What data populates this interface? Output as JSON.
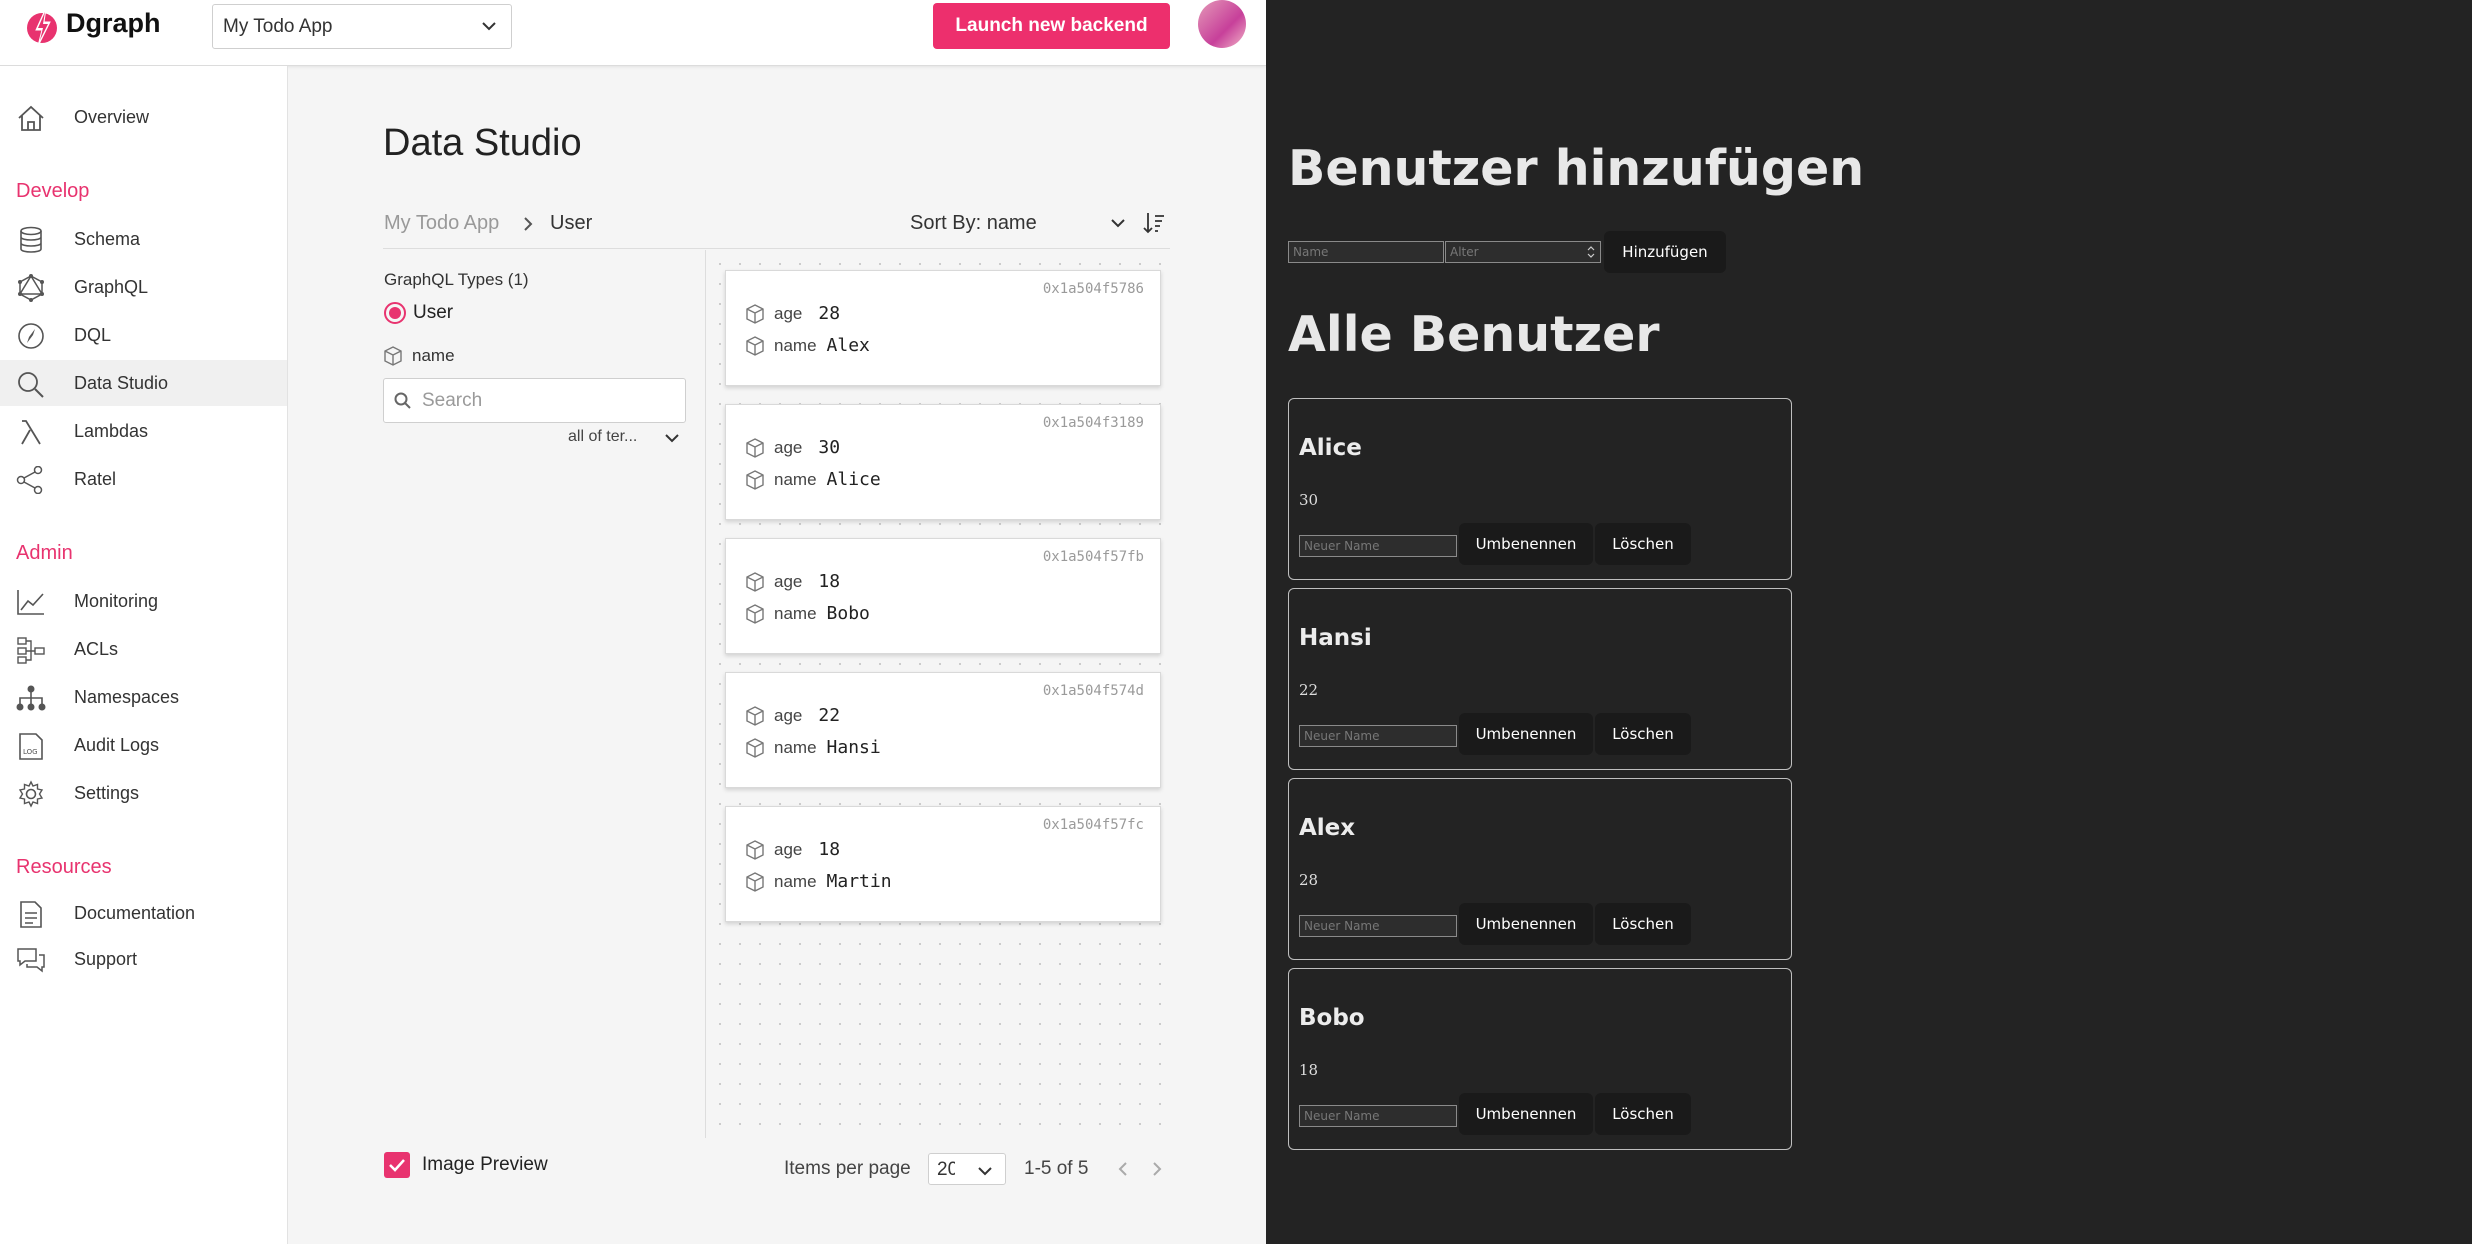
{
  "app": {
    "logo_text": "Dgraph",
    "backend_select": "My Todo App",
    "launch_button": "Launch new backend",
    "colors": {
      "accent": "#e8336f",
      "sidebar_active": "#f0f0f0",
      "dark_bg": "#232323"
    }
  },
  "sidebar": {
    "overview": "Overview",
    "develop_heading": "Develop",
    "develop": [
      {
        "label": "Schema",
        "icon": "database-icon"
      },
      {
        "label": "GraphQL",
        "icon": "graphql-icon"
      },
      {
        "label": "DQL",
        "icon": "compass-icon"
      },
      {
        "label": "Data Studio",
        "icon": "search-icon"
      },
      {
        "label": "Lambdas",
        "icon": "lambda-icon"
      },
      {
        "label": "Ratel",
        "icon": "graph-nodes-icon"
      }
    ],
    "admin_heading": "Admin",
    "admin": [
      {
        "label": "Monitoring",
        "icon": "line-chart-icon"
      },
      {
        "label": "ACLs",
        "icon": "acl-icon"
      },
      {
        "label": "Namespaces",
        "icon": "hierarchy-icon"
      },
      {
        "label": "Audit Logs",
        "icon": "log-file-icon"
      },
      {
        "label": "Settings",
        "icon": "gear-icon"
      }
    ],
    "resources_heading": "Resources",
    "resources": [
      {
        "label": "Documentation",
        "icon": "document-icon"
      },
      {
        "label": "Support",
        "icon": "chat-icon"
      }
    ]
  },
  "studio": {
    "title": "Data Studio",
    "breadcrumb_root": "My Todo App",
    "breadcrumb_type": "User",
    "sort_label": "Sort By: name",
    "types_heading": "GraphQL Types (1)",
    "type_option": "User",
    "field_name": "name",
    "search_placeholder": "Search",
    "filter_mode": "all of ter...",
    "image_preview_label": "Image Preview",
    "items_per_page_label": "Items per page",
    "items_per_page_value": "20",
    "pagination_text": "1-5 of 5",
    "records": [
      {
        "uid": "0x1a504f5786",
        "age": "28",
        "name": "Alex"
      },
      {
        "uid": "0x1a504f3189",
        "age": "30",
        "name": "Alice"
      },
      {
        "uid": "0x1a504f57fb",
        "age": "18",
        "name": "Bobo"
      },
      {
        "uid": "0x1a504f574d",
        "age": "22",
        "name": "Hansi"
      },
      {
        "uid": "0x1a504f57fc",
        "age": "18",
        "name": "Martin"
      }
    ],
    "age_label": "age",
    "name_label": "name"
  },
  "right_app": {
    "add_heading": "Benutzer hinzufügen",
    "name_placeholder": "Name",
    "age_placeholder": "Alter",
    "add_button": "Hinzufügen",
    "list_heading": "Alle Benutzer",
    "new_name_placeholder": "Neuer Name",
    "rename_button": "Umbenennen",
    "delete_button": "Löschen",
    "users": [
      {
        "name": "Alice",
        "age": "30"
      },
      {
        "name": "Hansi",
        "age": "22"
      },
      {
        "name": "Alex",
        "age": "28"
      },
      {
        "name": "Bobo",
        "age": "18"
      }
    ]
  }
}
